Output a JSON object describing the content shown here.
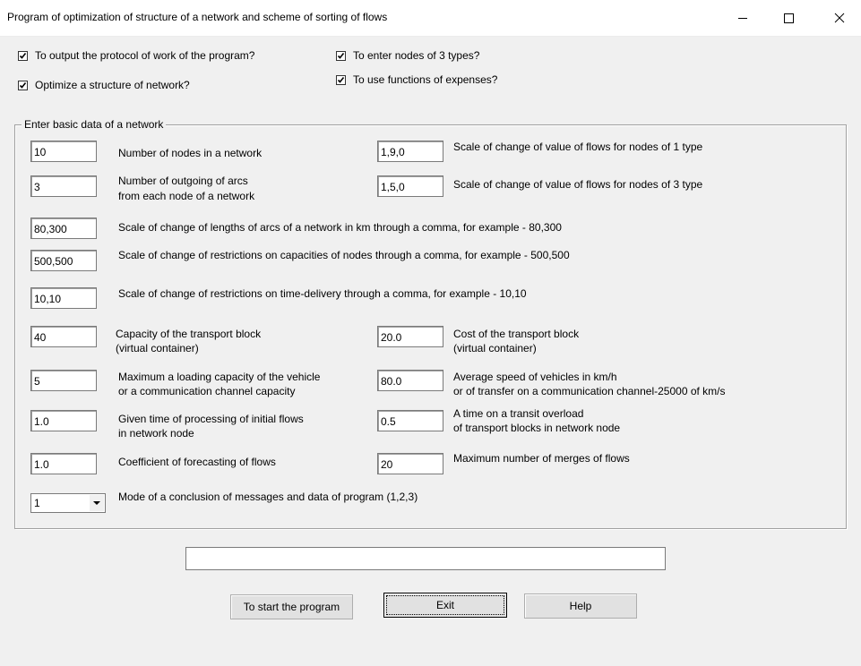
{
  "window": {
    "title": "Program of optimization of structure of a network and scheme of sorting of flows"
  },
  "options": {
    "output_protocol": {
      "label": "To output the protocol of work of the program?",
      "checked": true
    },
    "optimize_structure": {
      "label": "Optimize a structure of network?",
      "checked": true
    },
    "enter_nodes_3_types": {
      "label": "To enter nodes of 3 types?",
      "checked": true
    },
    "use_expense_functions": {
      "label": "To use functions of expenses?",
      "checked": true
    }
  },
  "group": {
    "legend": "Enter basic data of a network",
    "nodes_count": {
      "value": "10",
      "label": "Number of nodes in a network"
    },
    "outgoing_arcs": {
      "value": "3",
      "label_1": "Number of outgoing of arcs",
      "label_2": "from each node of a network"
    },
    "flow_scale_type1": {
      "value": "1,9,0",
      "label": "Scale of change of value of flows for nodes of 1 type"
    },
    "flow_scale_type3": {
      "value": "1,5,0",
      "label": "Scale of change of value of flows for nodes of 3 type"
    },
    "arc_lengths": {
      "value": "80,300",
      "label": "Scale of change of lengths of arcs of a network in km through a comma, for example - 80,300"
    },
    "node_capacities": {
      "value": "500,500",
      "label": "Scale of change of restrictions on capacities of nodes through a comma, for example - 500,500"
    },
    "time_delivery": {
      "value": "10,10",
      "label": "Scale of change of restrictions on time-delivery through a comma, for example - 10,10"
    },
    "block_capacity": {
      "value": "40",
      "label_1": "Capacity of the transport block",
      "label_2": "(virtual container)"
    },
    "block_cost": {
      "value": "20.0",
      "label_1": "Cost of the transport block",
      "label_2": "(virtual container)"
    },
    "vehicle_capacity": {
      "value": "5",
      "label_1": "Maximum a loading capacity of the vehicle",
      "label_2": "or a communication channel capacity"
    },
    "vehicle_speed": {
      "value": "80.0",
      "label_1": "Average speed of vehicles in km/h",
      "label_2": "or of transfer on a communication channel-25000 of km/s"
    },
    "processing_time": {
      "value": "1.0",
      "label_1": "Given time of processing of initial flows",
      "label_2": "in network node"
    },
    "transit_time": {
      "value": "0.5",
      "label_1": "A time on a transit overload",
      "label_2": "of transport blocks in network node"
    },
    "forecast_coef": {
      "value": "1.0",
      "label": "Coefficient of forecasting of flows"
    },
    "max_merges": {
      "value": "20",
      "label": "Maximum number of merges of flows"
    },
    "mode": {
      "value": "1",
      "label": "Mode of a conclusion of messages and data of program (1,2,3)"
    }
  },
  "progress": {
    "value": ""
  },
  "buttons": {
    "start": "To start the program",
    "exit": "Exit",
    "help": "Help"
  }
}
